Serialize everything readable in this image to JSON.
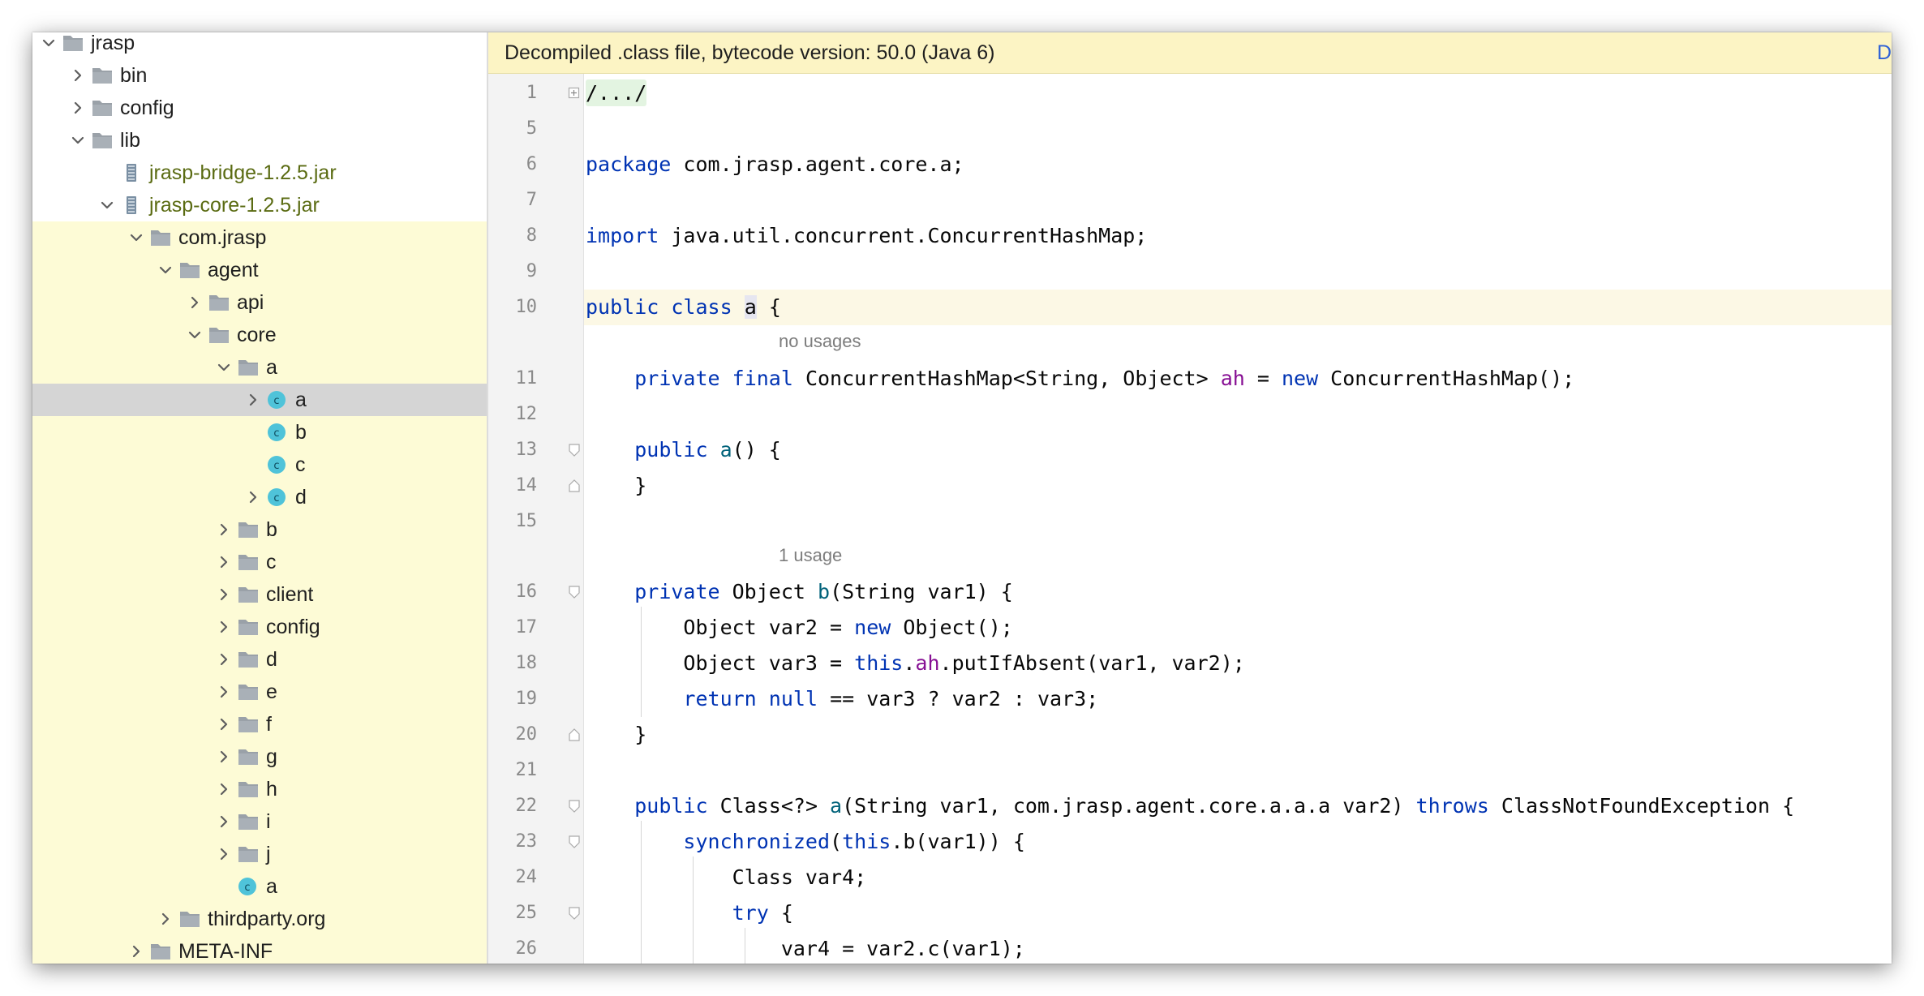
{
  "project_tree": {
    "items": [
      {
        "label": "jrasp",
        "depth": 0,
        "state": "open",
        "icon": "folder-icon"
      },
      {
        "label": "bin",
        "depth": 1,
        "state": "closed",
        "icon": "folder-icon"
      },
      {
        "label": "config",
        "depth": 1,
        "state": "closed",
        "icon": "folder-icon"
      },
      {
        "label": "lib",
        "depth": 1,
        "state": "open",
        "icon": "folder-icon"
      },
      {
        "label": "jrasp-bridge-1.2.5.jar",
        "depth": 2,
        "state": "none",
        "icon": "jar-icon",
        "style": "jar"
      },
      {
        "label": "jrasp-core-1.2.5.jar",
        "depth": 2,
        "state": "open",
        "icon": "jar-icon",
        "style": "jar"
      },
      {
        "label": "com.jrasp",
        "depth": 3,
        "state": "open",
        "icon": "package-icon",
        "highlighted": true
      },
      {
        "label": "agent",
        "depth": 4,
        "state": "open",
        "icon": "package-icon",
        "highlighted": true
      },
      {
        "label": "api",
        "depth": 5,
        "state": "closed",
        "icon": "package-icon",
        "highlighted": true
      },
      {
        "label": "core",
        "depth": 5,
        "state": "open",
        "icon": "package-icon",
        "highlighted": true
      },
      {
        "label": "a",
        "depth": 6,
        "state": "open",
        "icon": "package-icon",
        "highlighted": true
      },
      {
        "label": "a",
        "depth": 7,
        "state": "closed",
        "icon": "class-icon",
        "selected": true
      },
      {
        "label": "b",
        "depth": 7,
        "state": "none",
        "icon": "class-icon",
        "highlighted": true
      },
      {
        "label": "c",
        "depth": 7,
        "state": "none",
        "icon": "class-icon",
        "highlighted": true
      },
      {
        "label": "d",
        "depth": 7,
        "state": "closed",
        "icon": "class-icon",
        "highlighted": true
      },
      {
        "label": "b",
        "depth": 6,
        "state": "closed",
        "icon": "package-icon",
        "highlighted": true
      },
      {
        "label": "c",
        "depth": 6,
        "state": "closed",
        "icon": "package-icon",
        "highlighted": true
      },
      {
        "label": "client",
        "depth": 6,
        "state": "closed",
        "icon": "package-icon",
        "highlighted": true
      },
      {
        "label": "config",
        "depth": 6,
        "state": "closed",
        "icon": "package-icon",
        "highlighted": true
      },
      {
        "label": "d",
        "depth": 6,
        "state": "closed",
        "icon": "package-icon",
        "highlighted": true
      },
      {
        "label": "e",
        "depth": 6,
        "state": "closed",
        "icon": "package-icon",
        "highlighted": true
      },
      {
        "label": "f",
        "depth": 6,
        "state": "closed",
        "icon": "package-icon",
        "highlighted": true
      },
      {
        "label": "g",
        "depth": 6,
        "state": "closed",
        "icon": "package-icon",
        "highlighted": true
      },
      {
        "label": "h",
        "depth": 6,
        "state": "closed",
        "icon": "package-icon",
        "highlighted": true
      },
      {
        "label": "i",
        "depth": 6,
        "state": "closed",
        "icon": "package-icon",
        "highlighted": true
      },
      {
        "label": "j",
        "depth": 6,
        "state": "closed",
        "icon": "package-icon",
        "highlighted": true
      },
      {
        "label": "a",
        "depth": 6,
        "state": "none",
        "icon": "class-icon",
        "highlighted": true
      },
      {
        "label": "thirdparty.org",
        "depth": 4,
        "state": "closed",
        "icon": "package-icon",
        "highlighted": true
      },
      {
        "label": "META-INF",
        "depth": 3,
        "state": "closed",
        "icon": "folder-icon",
        "highlighted": true
      }
    ]
  },
  "editor": {
    "banner": {
      "text": "Decompiled .class file, bytecode version: 50.0 (Java 6)",
      "link": "D"
    },
    "hints": {
      "no_usages": "no usages",
      "one_usage": "1 usage"
    },
    "lines": [
      {
        "num": "1",
        "text": "/.../"
      },
      {
        "num": "5",
        "text": ""
      },
      {
        "num": "6",
        "text": "package com.jrasp.agent.core.a;"
      },
      {
        "num": "7",
        "text": ""
      },
      {
        "num": "8",
        "text": "import java.util.concurrent.ConcurrentHashMap;"
      },
      {
        "num": "9",
        "text": ""
      },
      {
        "num": "10",
        "text": "public class a {"
      },
      {
        "num": "11",
        "text": "    private final ConcurrentHashMap<String, Object> ah = new ConcurrentHashMap();"
      },
      {
        "num": "12",
        "text": ""
      },
      {
        "num": "13",
        "text": "    public a() {"
      },
      {
        "num": "14",
        "text": "    }"
      },
      {
        "num": "15",
        "text": ""
      },
      {
        "num": "16",
        "text": "    private Object b(String var1) {"
      },
      {
        "num": "17",
        "text": "        Object var2 = new Object();"
      },
      {
        "num": "18",
        "text": "        Object var3 = this.ah.putIfAbsent(var1, var2);"
      },
      {
        "num": "19",
        "text": "        return null == var3 ? var2 : var3;"
      },
      {
        "num": "20",
        "text": "    }"
      },
      {
        "num": "21",
        "text": ""
      },
      {
        "num": "22",
        "text": "    public Class<?> a(String var1, com.jrasp.agent.core.a.a.a var2) throws ClassNotFoundException {"
      },
      {
        "num": "23",
        "text": "        synchronized(this.b(var1)) {"
      },
      {
        "num": "24",
        "text": "            Class var4;"
      },
      {
        "num": "25",
        "text": "            try {"
      },
      {
        "num": "26",
        "text": "                var4 = var2.c(var1);"
      }
    ]
  },
  "colors": {
    "tree_highlight": "#fdfbd6",
    "tree_selected": "#d5d5d5",
    "banner_bg": "#fcf4c4",
    "keyword": "#0033b3",
    "method": "#00627a",
    "field": "#871094",
    "class_icon": "#4fc3d9"
  }
}
